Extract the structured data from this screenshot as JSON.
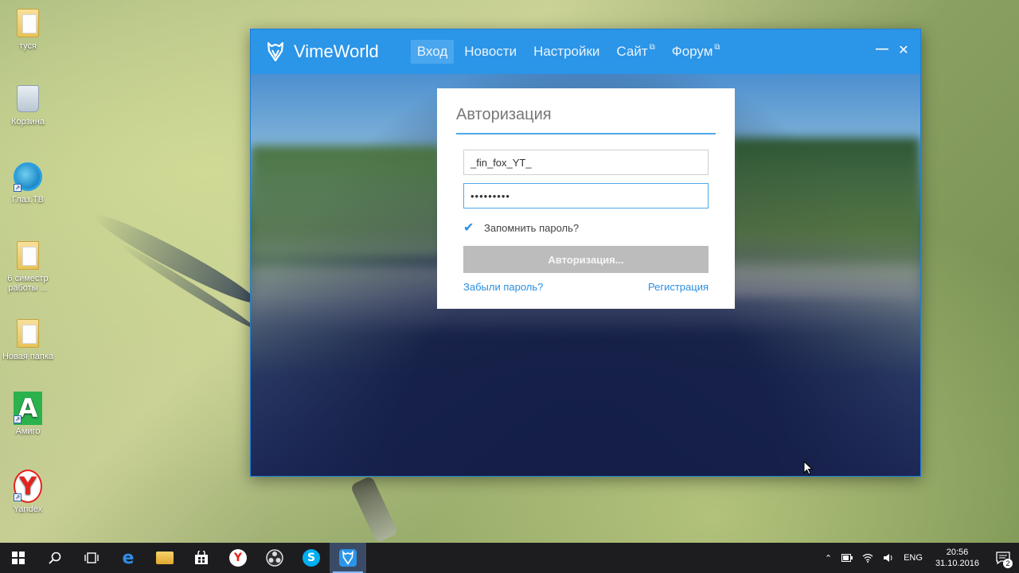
{
  "desktop": {
    "icons": [
      {
        "label": "туся",
        "icon": "folder-icon"
      },
      {
        "label": "Корзина",
        "icon": "recycle-bin-icon"
      },
      {
        "label": "Глаз.ТВ",
        "icon": "glaz-tv-icon"
      },
      {
        "label": "6 симестр работы ...",
        "icon": "folder-icon"
      },
      {
        "label": "Новая папка",
        "icon": "folder-icon"
      },
      {
        "label": "Амиго",
        "icon": "amigo-icon",
        "glyph": "A"
      },
      {
        "label": "Yandex",
        "icon": "yandex-icon",
        "glyph": "Y"
      }
    ]
  },
  "window": {
    "title": "VimeWorld",
    "nav": [
      {
        "label": "Вход",
        "active": true
      },
      {
        "label": "Новости"
      },
      {
        "label": "Настройки"
      },
      {
        "label": "Сайт",
        "external": true
      },
      {
        "label": "Форум",
        "external": true
      }
    ],
    "controls": {
      "minimize": "—",
      "close": "✕"
    },
    "accent_color": "#2b95e8"
  },
  "auth": {
    "title": "Авторизация",
    "username_value": "_fin_fox_YT_",
    "password_value": "•••••••••",
    "remember_label": "Запомнить пароль?",
    "remember_checked": true,
    "submit_label": "Авторизация...",
    "forgot_label": "Забыли пароль?",
    "register_label": "Регистрация"
  },
  "taskbar": {
    "apps": [
      {
        "name": "start",
        "icon": "windows-start-icon"
      },
      {
        "name": "search",
        "icon": "search-icon"
      },
      {
        "name": "task-view",
        "icon": "task-view-icon"
      },
      {
        "name": "edge",
        "icon": "edge-icon",
        "glyph": "e"
      },
      {
        "name": "explorer",
        "icon": "file-explorer-icon"
      },
      {
        "name": "store",
        "icon": "store-icon"
      },
      {
        "name": "yandex",
        "icon": "yandex-browser-icon",
        "glyph": "Y"
      },
      {
        "name": "obs",
        "icon": "obs-icon"
      },
      {
        "name": "skype",
        "icon": "skype-icon",
        "glyph": "S"
      },
      {
        "name": "vimeworld",
        "icon": "vimeworld-icon",
        "active": true
      }
    ],
    "tray": {
      "language": "ENG",
      "time": "20:56",
      "date": "31.10.2016",
      "notification_count": "2"
    }
  }
}
